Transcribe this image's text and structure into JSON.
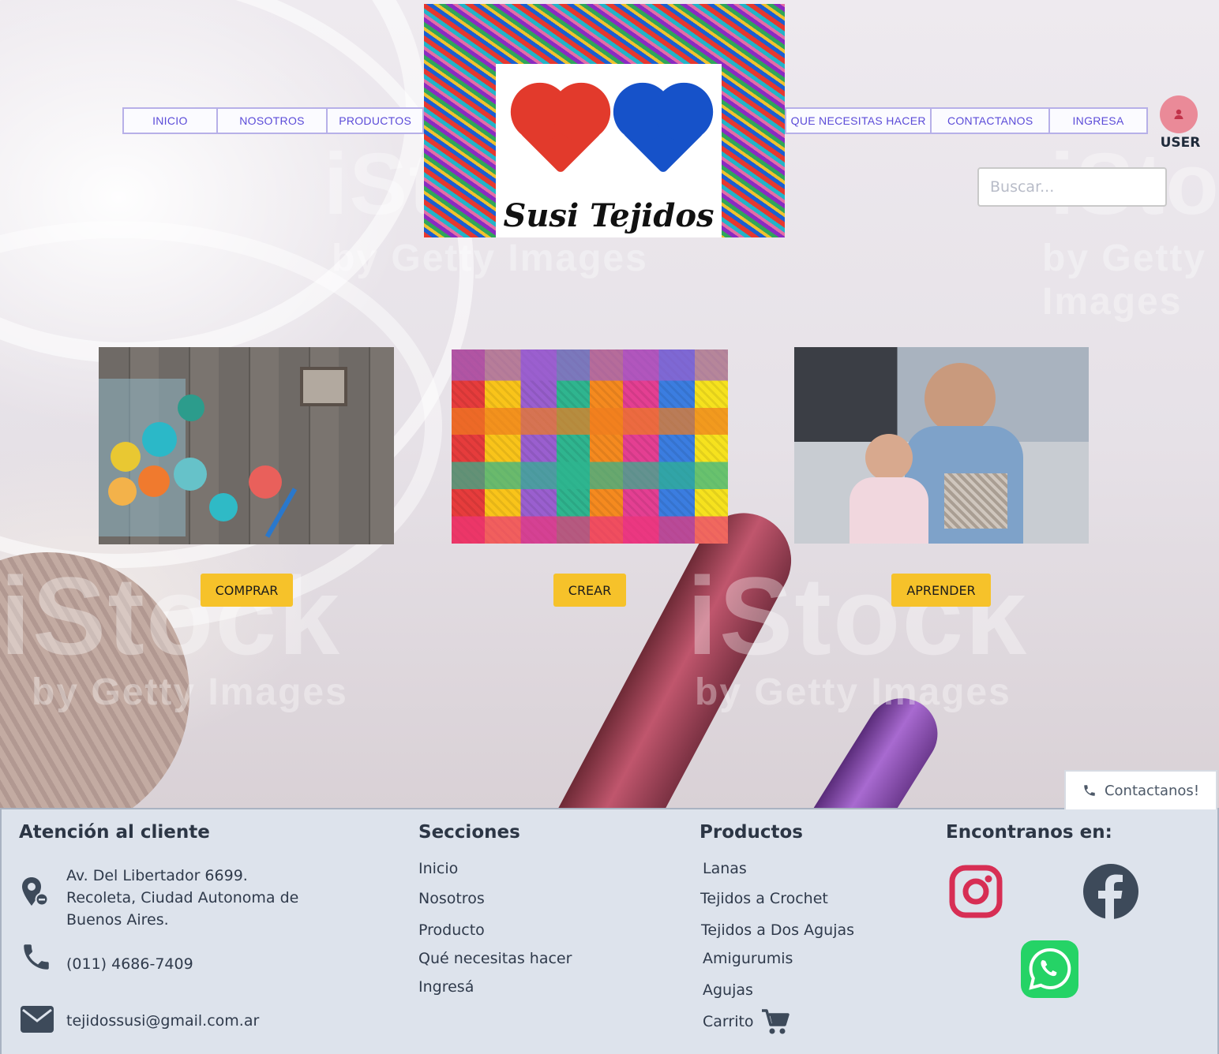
{
  "header": {
    "nav_left": [
      "INICIO",
      "NOSOTROS",
      "PRODUCTOS"
    ],
    "nav_right": [
      "QUE NECESITAS HACER",
      "CONTACTANOS",
      "INGRESA"
    ],
    "logo_text": "Susi Tejidos",
    "user_label": "USER",
    "search_placeholder": "Buscar..."
  },
  "hero": {
    "watermark": "iStock",
    "watermark_sub": "by Getty Images",
    "cards": [
      {
        "button": "COMPRAR",
        "image": "yarn-balls-photo"
      },
      {
        "button": "CREAR",
        "image": "woven-threads-photo"
      },
      {
        "button": "APRENDER",
        "image": "father-daughter-knitting-photo"
      }
    ]
  },
  "contact_tab": {
    "label": "Contactanos!",
    "icon": "phone-icon"
  },
  "footer": {
    "atencion": {
      "title": "Atención al cliente",
      "address": [
        "Av. Del Libertador 6699.",
        "Recoleta, Ciudad Autonoma de",
        "Buenos Aires."
      ],
      "phone": "(011) 4686-7409",
      "email": "tejidossusi@gmail.com.ar"
    },
    "secciones": {
      "title": "Secciones",
      "links": [
        "Inicio",
        "Nosotros",
        "Producto",
        "Qué necesitas hacer",
        "Ingresá"
      ]
    },
    "productos": {
      "title": "Productos",
      "links": [
        "Lanas",
        "Tejidos a Crochet",
        "Tejidos a Dos Agujas",
        "Amigurumis",
        "Agujas",
        "Carrito"
      ]
    },
    "social": {
      "title": "Encontranos en:",
      "icons": [
        "instagram-icon",
        "facebook-icon",
        "whatsapp-icon"
      ],
      "colors": {
        "instagram": "#d72e54",
        "facebook": "#3d4a5a",
        "whatsapp": "#25d366"
      }
    }
  },
  "colors": {
    "accent_button": "#f6c22a",
    "nav_text": "#5b4bd8",
    "footer_bg": "#dde3ec",
    "avatar": "#ea8a98"
  }
}
